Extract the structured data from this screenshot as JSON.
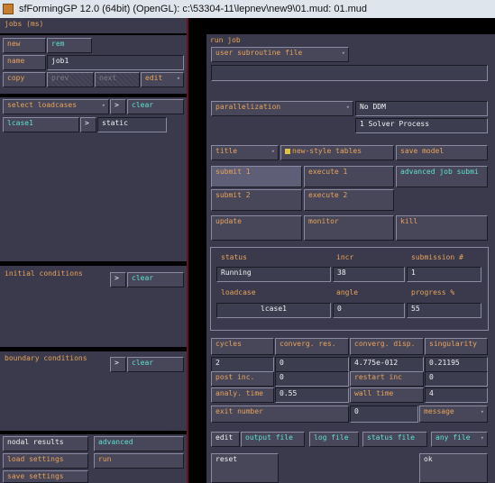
{
  "window": {
    "title": "sfFormingGP 12.0 (64bit) (OpenGL): c:\\53304-11\\lepnev\\new9\\01.mud: 01.mud"
  },
  "jobs_panel": {
    "title": "jobs (ms)",
    "new": "new",
    "rem": "rem",
    "name_label": "name",
    "name_value": "job1",
    "copy": "copy",
    "prev": "prev",
    "next": "next",
    "edit": "edit",
    "select_loadcases": "select loadcases",
    "arrow": ">",
    "clear": "clear",
    "loadcase_name": "lcase1",
    "loadcase_type": "static",
    "initial_conditions": "initial conditions",
    "boundary_conditions": "boundary conditions",
    "nodal_results": "nodal results",
    "advanced": "advanced",
    "load_settings": "load settings",
    "run": "run",
    "save_settings": "save settings"
  },
  "run_job": {
    "title": "run job",
    "user_subroutine_file": "user subroutine file",
    "user_subroutine_value": "",
    "parallelization": "parallelization",
    "ddm": "No DDM",
    "solver": "1 Solver Process",
    "title_btn": "title",
    "new_style_tables": "new-style tables",
    "save_model": "save model",
    "submit1": "submit 1",
    "execute1": "execute 1",
    "advanced_job_submit": "advanced job submi",
    "submit2": "submit 2",
    "execute2": "execute 2",
    "update": "update",
    "monitor": "monitor",
    "kill": "kill",
    "status_label": "status",
    "incr_label": "incr",
    "submission_label": "submission #",
    "status_value": "Running",
    "incr_value": "38",
    "submission_value": "1",
    "loadcase_label": "loadcase",
    "angle_label": "angle",
    "progress_label": "progress %",
    "loadcase_value": "lcase1",
    "angle_value": "0",
    "progress_value": "55",
    "cycles_label": "cycles",
    "converg_res_label": "converg. res.",
    "converg_disp_label": "converg. disp.",
    "singularity_label": "singularity",
    "cycles_value": "2",
    "converg_res_value": "0",
    "converg_disp_value": "4.775e-012",
    "singularity_value": "0.21195",
    "post_inc_label": "post inc.",
    "post_inc_value": "0",
    "restart_inc_label": "restart inc",
    "restart_inc_value": "0",
    "analy_time_label": "analy. time",
    "analy_time_value": "0.55",
    "wall_time_label": "wall time",
    "wall_time_value": "4",
    "exit_number_label": "exit number",
    "exit_number_value": "0",
    "message": "message",
    "edit": "edit",
    "output_file": "output file",
    "log_file": "log file",
    "status_file": "status file",
    "any_file": "any file",
    "reset": "reset",
    "ok": "ok"
  }
}
